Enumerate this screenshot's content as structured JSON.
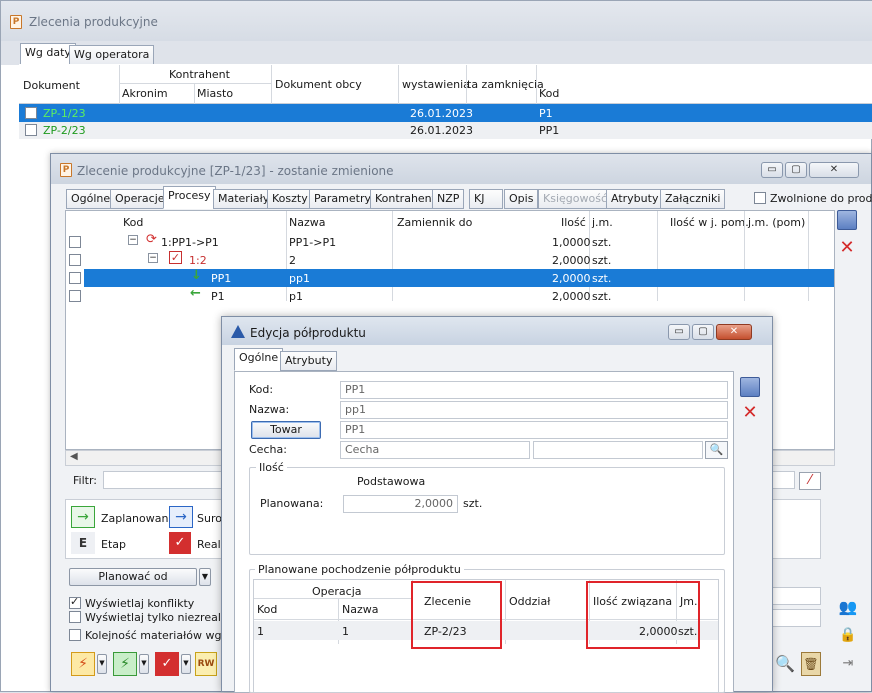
{
  "main_window": {
    "title": "Zlecenia produkcyjne",
    "tabs": [
      "Wg daty",
      "Wg operatora"
    ],
    "columns": {
      "dokument": "Dokument",
      "kontrahent": "Kontrahent",
      "akronim": "Akronim",
      "miasto": "Miasto",
      "dokument_obcy": "Dokument obcy",
      "wystawienia": "wystawienia",
      "zamkniecia": "ta zamknięcia",
      "kod": "Kod"
    },
    "rows": [
      {
        "dokument": "ZP-1/23",
        "data": "26.01.2023",
        "kod": "P1"
      },
      {
        "dokument": "ZP-2/23",
        "data": "26.01.2023",
        "kod": "PP1"
      }
    ]
  },
  "order_window": {
    "title": "Zlecenie produkcyjne  [ZP-1/23] - zostanie zmienione",
    "tabs": [
      "Ogólne",
      "Operacje",
      "Procesy",
      "Materiały",
      "Koszty",
      "Parametry",
      "Kontrahent",
      "NZP",
      "KJ",
      "Opis",
      "Księgowość",
      "Atrybuty",
      "Załączniki"
    ],
    "zwolnione_label": "Zwolnione do prod.",
    "columns": {
      "kod": "Kod",
      "nazwa": "Nazwa",
      "zamiennik": "Zamiennik do",
      "ilosc": "Ilość",
      "jm": "j.m.",
      "ilosc_pom": "Ilość w j. pom.",
      "jm_pom": "j.m. (pom)"
    },
    "rows": [
      {
        "kod": "1:PP1->P1",
        "nazwa": "PP1->P1",
        "ilosc": "1,0000",
        "jm": "szt."
      },
      {
        "kod": "1:2",
        "nazwa": "2",
        "ilosc": "2,0000",
        "jm": "szt."
      },
      {
        "kod": "PP1",
        "nazwa": "pp1",
        "ilosc": "2,0000",
        "jm": "szt."
      },
      {
        "kod": "P1",
        "nazwa": "p1",
        "ilosc": "2,0000",
        "jm": "szt."
      }
    ],
    "filter_label": "Filtr:",
    "legend": {
      "zaplanowane": "Zaplanowane",
      "surowce": "Surow",
      "etap": "Etap",
      "realizacja": "Reali"
    },
    "planowac_button": "Planować od",
    "options": {
      "konflikty": "Wyświetlaj konflikty",
      "niezrealizowane": "Wyświetlaj tylko niezrealizow",
      "kolejnosc": "Kolejność materiałów wg te"
    }
  },
  "edit_dialog": {
    "title": "Edycja półproduktu",
    "tabs": [
      "Ogólne",
      "Atrybuty"
    ],
    "kod_label": "Kod:",
    "kod_value": "PP1",
    "nazwa_label": "Nazwa:",
    "nazwa_value": "pp1",
    "towar_button": "Towar",
    "towar_value": "PP1",
    "cecha_label": "Cecha:",
    "cecha_placeholder": "Cecha",
    "ilosc_group": "Ilość",
    "podstawowa_label": "Podstawowa",
    "planowana_label": "Planowana:",
    "planowana_value": "2,0000",
    "planowana_unit": "szt.",
    "pochodzenie_group": "Planowane pochodzenie półproduktu",
    "columns": {
      "operacja": "Operacja",
      "kod": "Kod",
      "nazwa": "Nazwa",
      "zlecenie": "Zlecenie",
      "oddzial": "Oddział",
      "ilosc_zwiazana": "Ilość związana",
      "jm": "Jm."
    },
    "row": {
      "kod": "1",
      "nazwa": "1",
      "zlecenie": "ZP-2/23",
      "ilosc": "2,0000",
      "jm": "szt."
    }
  },
  "colors": {
    "selection": "#1a7bd6",
    "highlight_box": "#e0242a",
    "doc_link": "#1e9a1e"
  }
}
